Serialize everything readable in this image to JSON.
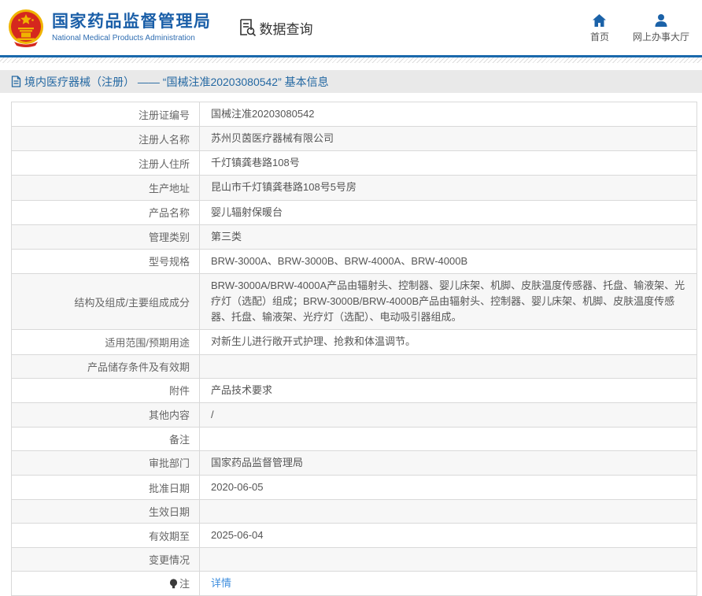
{
  "header": {
    "logo_title": "国家药品监督管理局",
    "logo_subtitle": "National Medical Products Administration",
    "data_query_label": "数据查询",
    "nav": [
      {
        "label": "首页",
        "icon": "home-icon"
      },
      {
        "label": "网上办事大厅",
        "icon": "user-icon"
      }
    ]
  },
  "breadcrumb": {
    "text": "境内医疗器械（注册） —— “国械注准20203080542” 基本信息"
  },
  "table": {
    "rows": [
      {
        "label": "注册证编号",
        "value": "国械注准20203080542"
      },
      {
        "label": "注册人名称",
        "value": "苏州贝茵医疗器械有限公司"
      },
      {
        "label": "注册人住所",
        "value": "千灯镇龚巷路108号"
      },
      {
        "label": "生产地址",
        "value": "昆山市千灯镇龚巷路108号5号房"
      },
      {
        "label": "产品名称",
        "value": "婴儿辐射保暖台"
      },
      {
        "label": "管理类别",
        "value": "第三类"
      },
      {
        "label": "型号规格",
        "value": "BRW-3000A、BRW-3000B、BRW-4000A、BRW-4000B"
      },
      {
        "label": "结构及组成/主要组成成分",
        "value": "BRW-3000A/BRW-4000A产品由辐射头、控制器、婴儿床架、机脚、皮肤温度传感器、托盘、输液架、光疗灯（选配）组成；BRW-3000B/BRW-4000B产品由辐射头、控制器、婴儿床架、机脚、皮肤温度传感器、托盘、输液架、光疗灯（选配）、电动吸引器组成。"
      },
      {
        "label": "适用范围/预期用途",
        "value": "对新生儿进行敞开式护理、抢救和体温调节。"
      },
      {
        "label": "产品储存条件及有效期",
        "value": ""
      },
      {
        "label": "附件",
        "value": "产品技术要求"
      },
      {
        "label": "其他内容",
        "value": "/"
      },
      {
        "label": "备注",
        "value": ""
      },
      {
        "label": "审批部门",
        "value": "国家药品监督管理局"
      },
      {
        "label": "批准日期",
        "value": "2020-06-05"
      },
      {
        "label": "生效日期",
        "value": ""
      },
      {
        "label": "有效期至",
        "value": "2025-06-04"
      },
      {
        "label": "变更情况",
        "value": ""
      },
      {
        "label": "注",
        "value": "详情",
        "link": true,
        "icon": "note-icon"
      }
    ]
  },
  "colors": {
    "brand_blue": "#1b5fa8",
    "line_blue": "#1a69ac",
    "breadcrumb_bg": "#e9e9e9",
    "breadcrumb_text": "#2468a2",
    "row_alt_bg": "#f7f7f7",
    "link_blue": "#3e8ede",
    "emblem_red": "#d5281e",
    "emblem_gold": "#f0b400"
  }
}
